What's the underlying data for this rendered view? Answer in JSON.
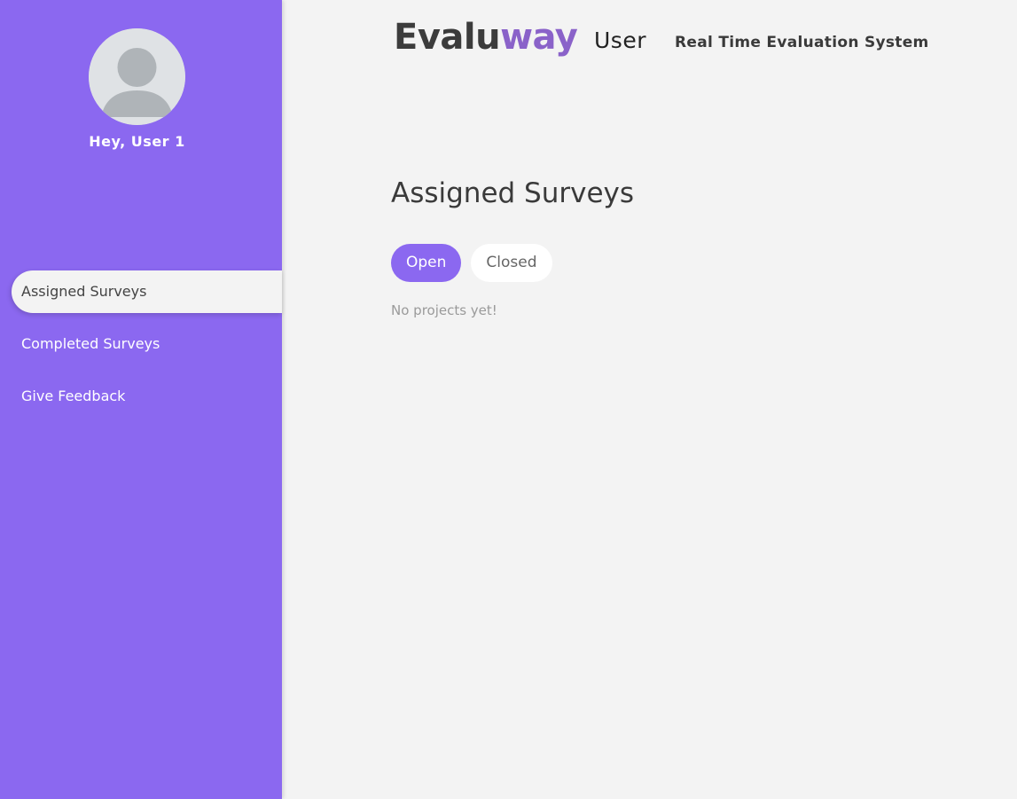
{
  "sidebar": {
    "greeting": "Hey, User 1",
    "items": [
      {
        "label": "Assigned Surveys",
        "active": true
      },
      {
        "label": "Completed Surveys",
        "active": false
      },
      {
        "label": "Give Feedback",
        "active": false
      }
    ]
  },
  "header": {
    "logo_part1": "Evalu",
    "logo_part2": "way",
    "role": "User",
    "tagline": "Real Time Evaluation System"
  },
  "main": {
    "title": "Assigned Surveys",
    "tabs": [
      {
        "label": "Open",
        "active": true
      },
      {
        "label": "Closed",
        "active": false
      }
    ],
    "empty_message": "No projects yet!"
  },
  "colors": {
    "accent": "#8b68f0",
    "logo_accent": "#8a62c9",
    "background": "#f3f3f3"
  },
  "icons": {
    "avatar": "user-avatar-icon"
  }
}
